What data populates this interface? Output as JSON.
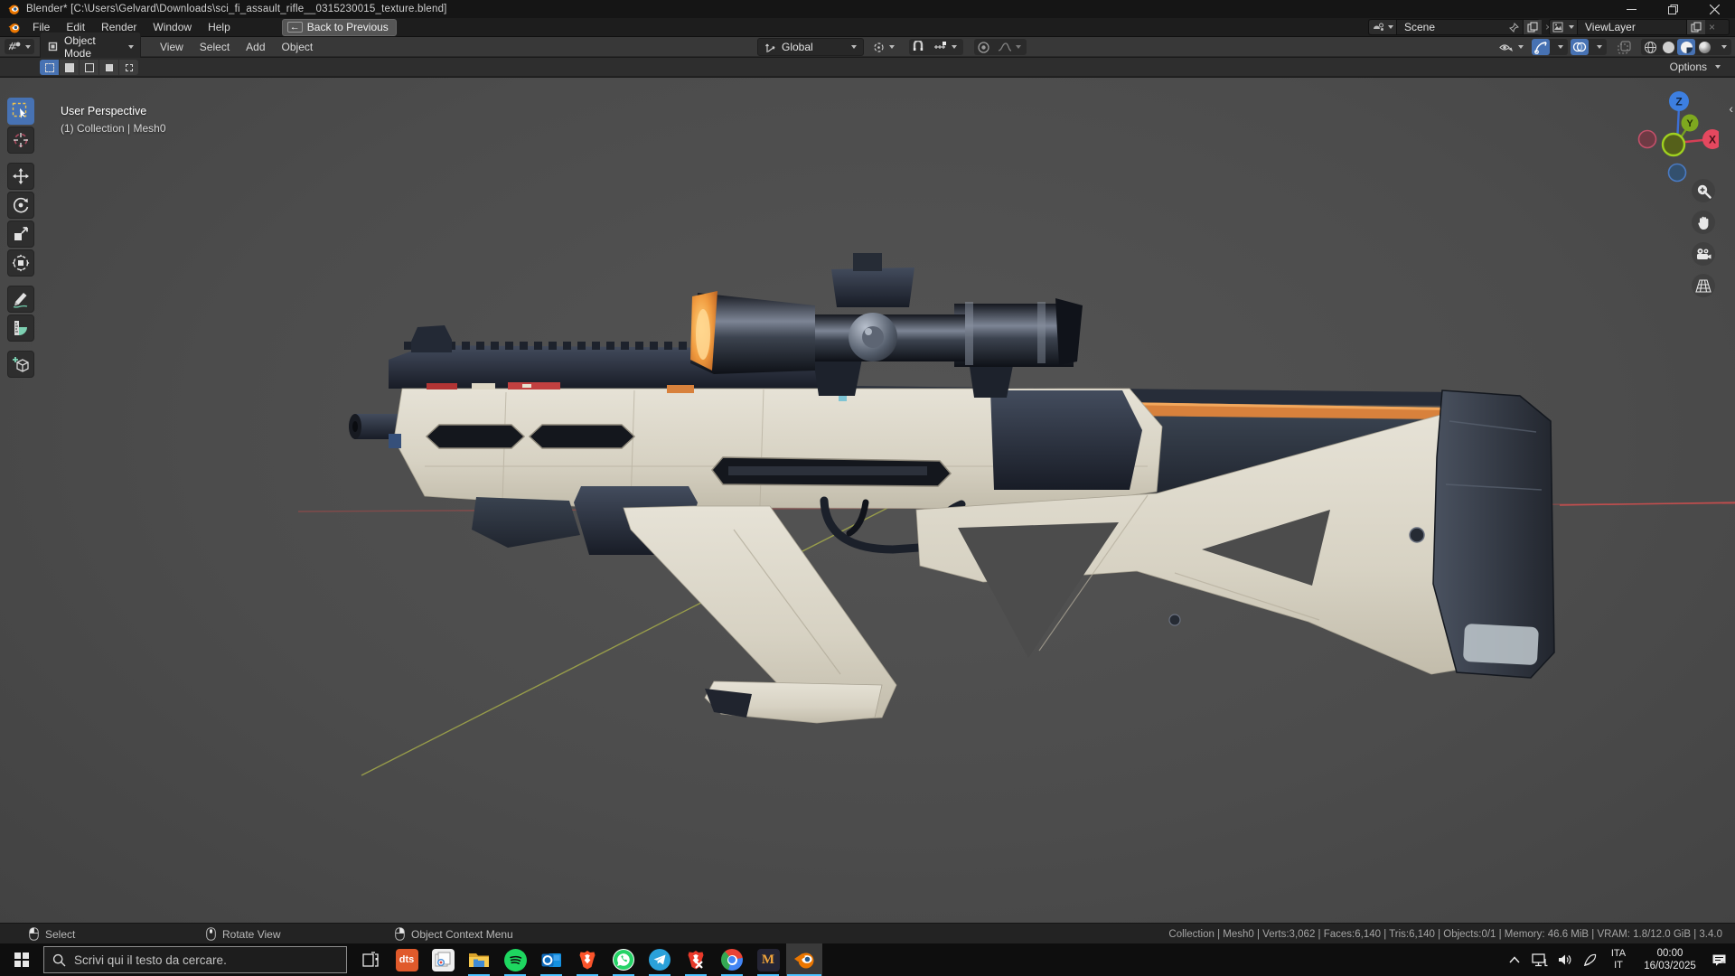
{
  "window": {
    "title": "Blender* [C:\\Users\\Gelvard\\Downloads\\sci_fi_assault_rifle__0315230015_texture.blend]"
  },
  "topbar": {
    "menus": [
      "File",
      "Edit",
      "Render",
      "Window",
      "Help"
    ],
    "back_button": "Back to Previous",
    "back_icon": "←",
    "scene": "Scene",
    "view_layer": "ViewLayer"
  },
  "tool_header": {
    "mode": "Object Mode",
    "menus": [
      "View",
      "Select",
      "Add",
      "Object"
    ],
    "orientation": "Global"
  },
  "tool_settings": {
    "options": "Options"
  },
  "viewport": {
    "overlay_line1": "User Perspective",
    "overlay_line2": "(1) Collection | Mesh0",
    "gizmo": {
      "x": "X",
      "y": "Y",
      "z": "Z"
    },
    "tools": [
      "select-box",
      "cursor",
      "move",
      "rotate",
      "scale",
      "transform",
      "annotate",
      "measure",
      "add-cube"
    ],
    "nav_buttons": [
      "zoom",
      "pan",
      "camera",
      "orthographic"
    ]
  },
  "status_bar": {
    "hints": [
      {
        "mouse": "left",
        "label": "Select"
      },
      {
        "mouse": "middle",
        "label": "Rotate View"
      },
      {
        "mouse": "right",
        "label": "Object Context Menu"
      }
    ],
    "stats": "Collection | Mesh0 | Verts:3,062 | Faces:6,140 | Tris:6,140 | Objects:0/1 | Memory: 46.6 MiB | VRAM: 1.8/12.0 GiB | 3.4.0"
  },
  "taskbar": {
    "search_placeholder": "Scrivi qui il testo da cercare.",
    "apps": [
      "task-view",
      "dts",
      "photos",
      "file-explorer",
      "spotify",
      "outlook",
      "brave",
      "whatsapp",
      "telegram",
      "brave-dev",
      "chrome",
      "gmail",
      "blender"
    ],
    "dts_label": "dts",
    "gmail_label": "M",
    "tray": {
      "lang_line1": "ITA",
      "lang_line2": "IT",
      "time": "00:00",
      "date": "16/03/2025"
    }
  },
  "colors": {
    "accent_blue": "#4772b3",
    "taskbar_indicator": "#4cc2ff",
    "viewport_bg": "#4e4e4e",
    "rifle_body": "#d9d4c6",
    "rifle_dark": "#2c3442",
    "rifle_accent_orange": "#d8813c"
  }
}
